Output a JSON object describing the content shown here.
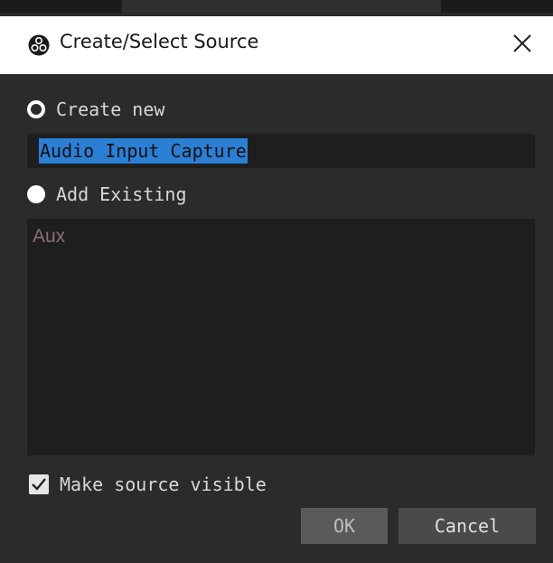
{
  "window": {
    "title": "Create/Select Source",
    "icon": "obs-logo-icon",
    "close_icon": "close-icon"
  },
  "create_new": {
    "label": "Create new",
    "selected": false,
    "name_value": "Audio Input Capture"
  },
  "add_existing": {
    "label": "Add Existing",
    "selected": true,
    "items": [
      "Aux"
    ]
  },
  "visibility": {
    "label": "Make source visible",
    "checked": true
  },
  "buttons": {
    "ok_label": "OK",
    "cancel_label": "Cancel"
  },
  "colors": {
    "panel_bg": "#2b2b2b",
    "field_bg": "#1e1e1e",
    "selection_highlight": "#2b7fd4",
    "list_item_text": "#8a6f78"
  }
}
